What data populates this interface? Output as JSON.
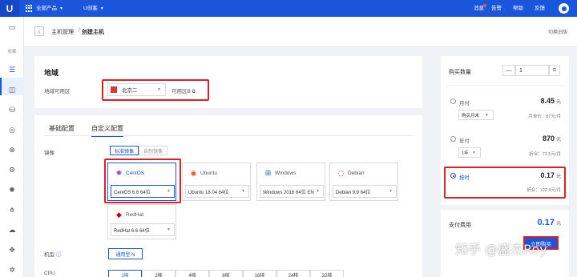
{
  "topbar": {
    "logo": "U",
    "all_products": "全部产品",
    "project": "U创客",
    "messages": "消息",
    "alerts": "告警",
    "help": "帮助",
    "feedback": "反馈"
  },
  "sidebar": {
    "favorites_label": "收藏"
  },
  "breadcrumb": {
    "parent": "主机管理",
    "current": "创建主机",
    "switch_version": "切换旧版"
  },
  "region": {
    "title": "地域",
    "zone_label": "地域可用区",
    "region_value": "北京二",
    "zone_value": "可用区B"
  },
  "config_tabs": {
    "basic": "基础配置",
    "custom": "自定义配置"
  },
  "image": {
    "label": "镜像",
    "standard_tab": "标准镜像",
    "custom_tab": "自制镜像",
    "os": [
      {
        "name": "CentOS",
        "version": "CentOS 6.6 64位",
        "color": "#a23bb5"
      },
      {
        "name": "Ubuntu",
        "version": "Ubuntu 18.04 64位",
        "color": "#e95420"
      },
      {
        "name": "Windows",
        "version": "Windows 2016 64位 EN",
        "color": "#0078d7"
      },
      {
        "name": "Debian",
        "version": "Debian 9.9 64位",
        "color": "#d70a53"
      },
      {
        "name": "RedHat",
        "version": "RedHat 6.6 64位",
        "color": "#cc0000"
      }
    ]
  },
  "machine_type": {
    "label": "机型",
    "value": "通用型 N"
  },
  "cpu": {
    "label": "CPU",
    "options": [
      "1核",
      "2核",
      "4核",
      "8核",
      "16核",
      "24核",
      "32核"
    ]
  },
  "purchase": {
    "qty_label": "购买数量",
    "qty_minus": "—",
    "qty_value": "1",
    "monthly": {
      "label": "月付",
      "price": "8.45",
      "unit": "元",
      "select": "购买月末",
      "note": "月单价：87元/月"
    },
    "yearly": {
      "label": "年付",
      "price": "870",
      "unit": "元",
      "select": "1年",
      "note": "折合：72.5元/月"
    },
    "hourly": {
      "label": "按时",
      "price": "0.17",
      "unit": "元",
      "note": "折合：122.4元/月"
    }
  },
  "payment": {
    "label": "支付费用",
    "price": "0.17",
    "unit": "元",
    "buy_button": "立即购买"
  },
  "watermark": "知乎 @盛杰Roy",
  "colors": {
    "accent": "#1a56db",
    "highlight_box": "#e02020"
  }
}
